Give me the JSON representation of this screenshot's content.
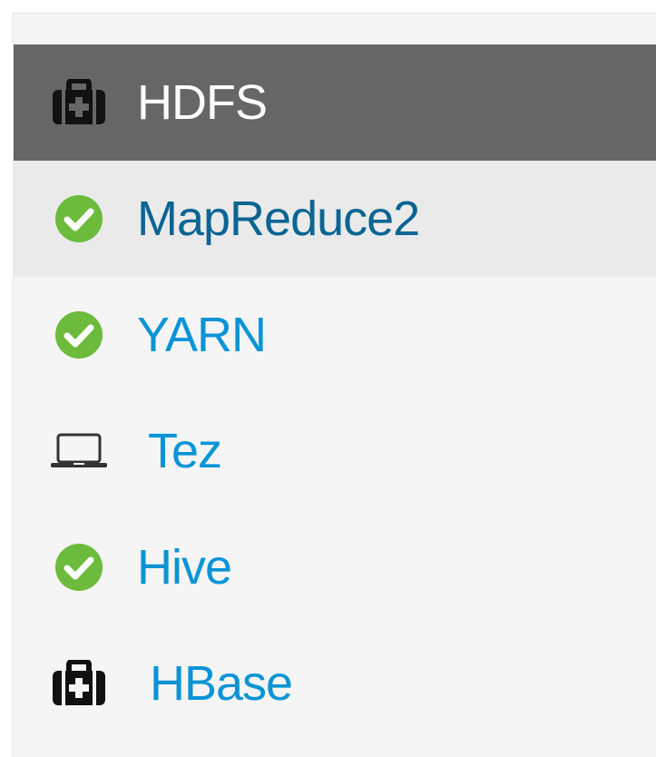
{
  "services": [
    {
      "label": "HDFS",
      "icon": "medkit-icon",
      "status": "maintenance",
      "state": "active"
    },
    {
      "label": "MapReduce2",
      "icon": "check-circle-icon",
      "status": "ok",
      "state": "hover"
    },
    {
      "label": "YARN",
      "icon": "check-circle-icon",
      "status": "ok",
      "state": "normal"
    },
    {
      "label": "Tez",
      "icon": "laptop-icon",
      "status": "client",
      "state": "normal"
    },
    {
      "label": "Hive",
      "icon": "check-circle-icon",
      "status": "ok",
      "state": "normal"
    },
    {
      "label": "HBase",
      "icon": "medkit-icon",
      "status": "maintenance",
      "state": "normal"
    }
  ],
  "colors": {
    "link": "#0a94d6",
    "link_hover": "#0b6594",
    "active_bg": "#666666",
    "hover_bg": "#eaeaea",
    "ok_green": "#6cbb3c",
    "panel_bg": "#f5f5f5"
  }
}
